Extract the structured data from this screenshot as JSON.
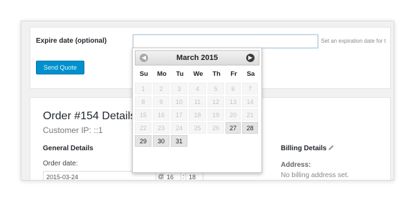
{
  "quote": {
    "expire_label": "Expire date (optional)",
    "expire_value": "",
    "expire_description": "Set an expiration date for t",
    "send_button": "Send Quote"
  },
  "order": {
    "title": "Order #154 Details",
    "customer_ip": "Customer IP: ::1",
    "general_details": "General Details",
    "order_date_label": "Order date:",
    "order_date_value": "2015-03-24",
    "at_sep": "@",
    "hour_value": "16",
    "colon_sep": ":",
    "minute_value": "18",
    "billing_title": "Billing Details",
    "address_label": "Address:",
    "no_billing": "No billing address set."
  },
  "datepicker": {
    "title": "March 2015",
    "prev_icon": "prev-arrow-icon",
    "next_icon": "next-arrow-icon",
    "days_of_week": [
      "Su",
      "Mo",
      "Tu",
      "We",
      "Th",
      "Fr",
      "Sa"
    ],
    "rows": [
      [
        {
          "d": "1",
          "s": "disabled"
        },
        {
          "d": "2",
          "s": "disabled"
        },
        {
          "d": "3",
          "s": "disabled"
        },
        {
          "d": "4",
          "s": "disabled"
        },
        {
          "d": "5",
          "s": "disabled"
        },
        {
          "d": "6",
          "s": "disabled"
        },
        {
          "d": "7",
          "s": "disabled"
        }
      ],
      [
        {
          "d": "8",
          "s": "disabled"
        },
        {
          "d": "9",
          "s": "disabled"
        },
        {
          "d": "10",
          "s": "disabled"
        },
        {
          "d": "11",
          "s": "disabled"
        },
        {
          "d": "12",
          "s": "disabled"
        },
        {
          "d": "13",
          "s": "disabled"
        },
        {
          "d": "14",
          "s": "disabled"
        }
      ],
      [
        {
          "d": "15",
          "s": "disabled"
        },
        {
          "d": "16",
          "s": "disabled"
        },
        {
          "d": "17",
          "s": "disabled"
        },
        {
          "d": "18",
          "s": "disabled"
        },
        {
          "d": "19",
          "s": "disabled"
        },
        {
          "d": "20",
          "s": "disabled"
        },
        {
          "d": "21",
          "s": "disabled"
        }
      ],
      [
        {
          "d": "22",
          "s": "disabled"
        },
        {
          "d": "23",
          "s": "disabled"
        },
        {
          "d": "24",
          "s": "disabled"
        },
        {
          "d": "25",
          "s": "disabled"
        },
        {
          "d": "26",
          "s": "disabled"
        },
        {
          "d": "27",
          "s": "active"
        },
        {
          "d": "28",
          "s": "active"
        }
      ],
      [
        {
          "d": "29",
          "s": "active"
        },
        {
          "d": "30",
          "s": "active"
        },
        {
          "d": "31",
          "s": "active"
        },
        {
          "d": "",
          "s": "empty"
        },
        {
          "d": "",
          "s": "empty"
        },
        {
          "d": "",
          "s": "empty"
        },
        {
          "d": "",
          "s": "empty"
        }
      ]
    ]
  },
  "colors": {
    "accent": "#0091cd",
    "disabled_day_bg": "#f6f6f6",
    "active_day_bg": "#e4e4e4"
  }
}
